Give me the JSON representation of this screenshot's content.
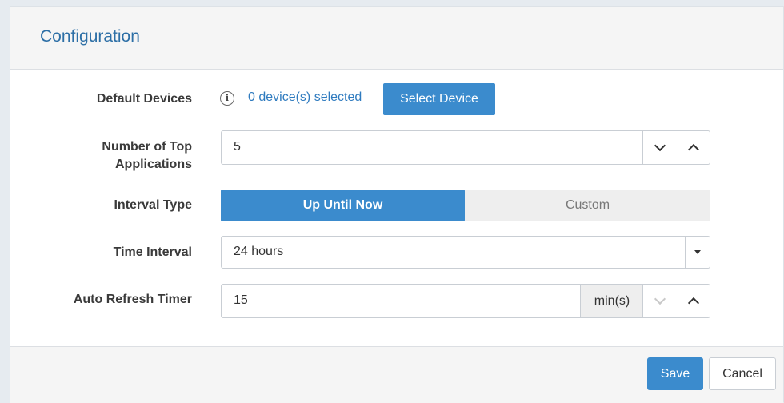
{
  "dialog": {
    "title": "Configuration"
  },
  "default_devices": {
    "label": "Default Devices",
    "info_icon": "info-icon",
    "info_glyph": "i",
    "count_text": "0 device(s) selected",
    "select_button_label": "Select Device"
  },
  "top_applications": {
    "label_line1": "Number of Top",
    "label_line2": "Applications",
    "value": "5"
  },
  "interval_type": {
    "label": "Interval Type",
    "options": [
      "Up Until Now",
      "Custom"
    ],
    "selected": "Up Until Now"
  },
  "time_interval": {
    "label": "Time Interval",
    "value": "24 hours"
  },
  "auto_refresh": {
    "label": "Auto Refresh Timer",
    "value": "15",
    "unit": "min(s)"
  },
  "footer": {
    "save_label": "Save",
    "cancel_label": "Cancel"
  },
  "colors": {
    "accent": "#3b8bcd",
    "title": "#2d6fa6",
    "link": "#2f7bbf"
  }
}
